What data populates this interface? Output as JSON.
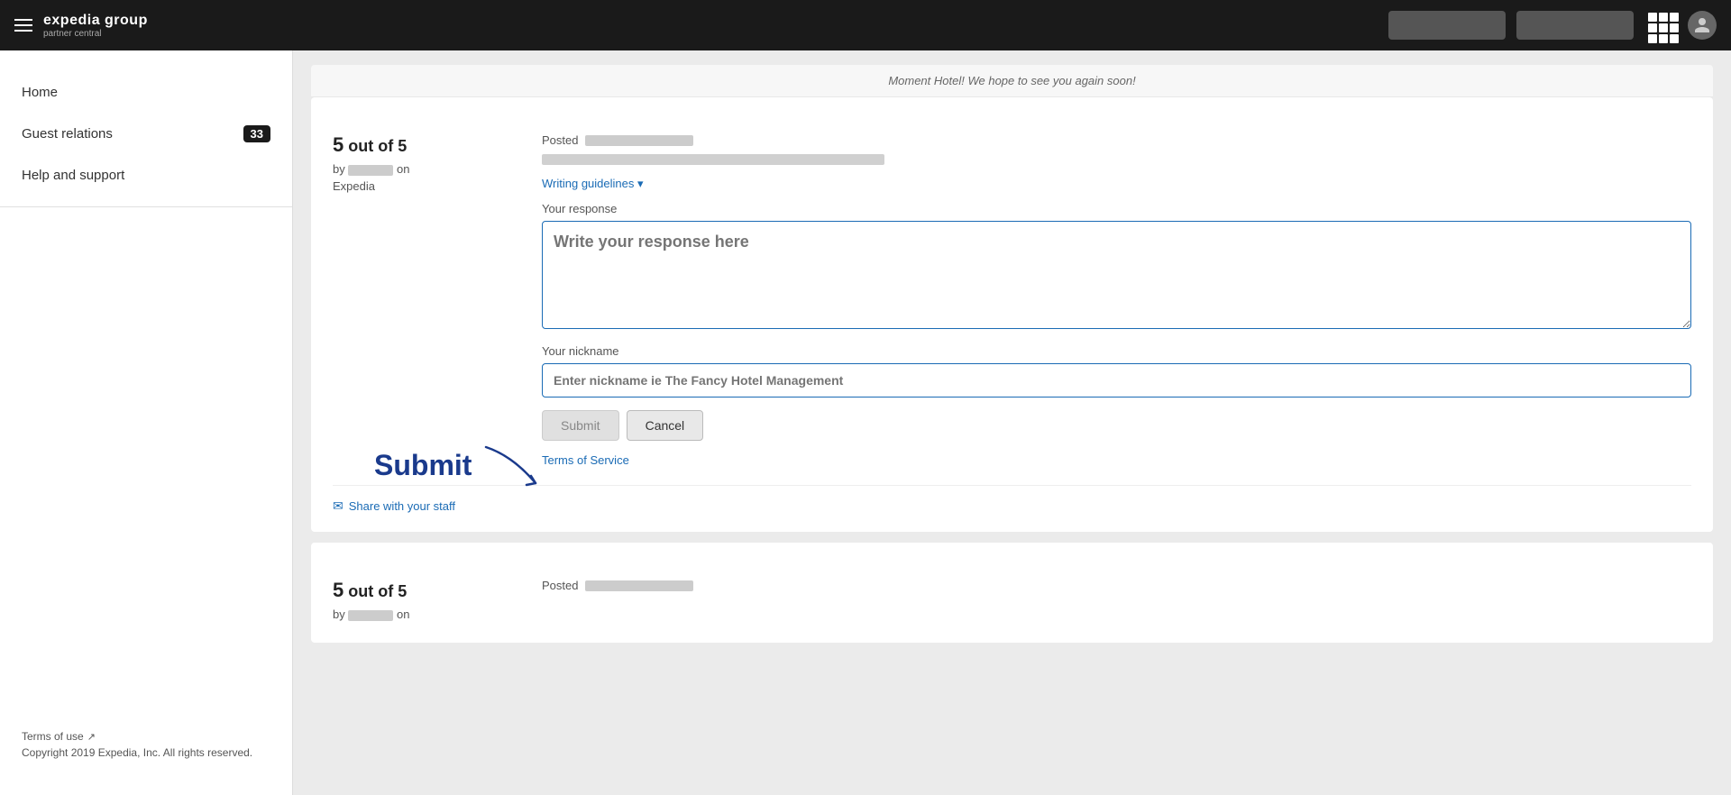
{
  "header": {
    "hamburger_label": "menu",
    "logo_main": "expedia group",
    "logo_sub": "partner central",
    "btn1_label": "",
    "btn2_label": "",
    "grid_icon": "grid-icon",
    "avatar_icon": "user-avatar"
  },
  "sidebar": {
    "items": [
      {
        "id": "home",
        "label": "Home",
        "badge": null
      },
      {
        "id": "guest-relations",
        "label": "Guest relations",
        "badge": "33"
      },
      {
        "id": "help-and-support",
        "label": "Help and support",
        "badge": null
      }
    ],
    "footer": {
      "terms_label": "Terms of use",
      "copyright": "Copyright 2019 Expedia, Inc. All rights reserved."
    }
  },
  "main": {
    "top_message": "Moment Hotel! We hope to see you again soon!",
    "review1": {
      "rating_score": "5",
      "rating_out_of": "out of 5",
      "by_label": "by",
      "reviewer_name_redacted": true,
      "on_label": "on",
      "source": "Expedia",
      "posted_label": "Posted",
      "writing_guidelines_label": "Writing guidelines ▾",
      "your_response_label": "Your response",
      "response_placeholder": "Write your response here",
      "nickname_label": "Your nickname",
      "nickname_placeholder": "Enter nickname ie The Fancy Hotel Management",
      "submit_btn": "Submit",
      "cancel_btn": "Cancel",
      "terms_service_label": "Terms of Service",
      "share_label": "Share with your staff"
    },
    "annotation": {
      "submit_text": "Submit",
      "arrow": "↘"
    },
    "review2": {
      "rating_score": "5",
      "rating_out_of": "out of 5",
      "posted_label": "Posted"
    }
  }
}
